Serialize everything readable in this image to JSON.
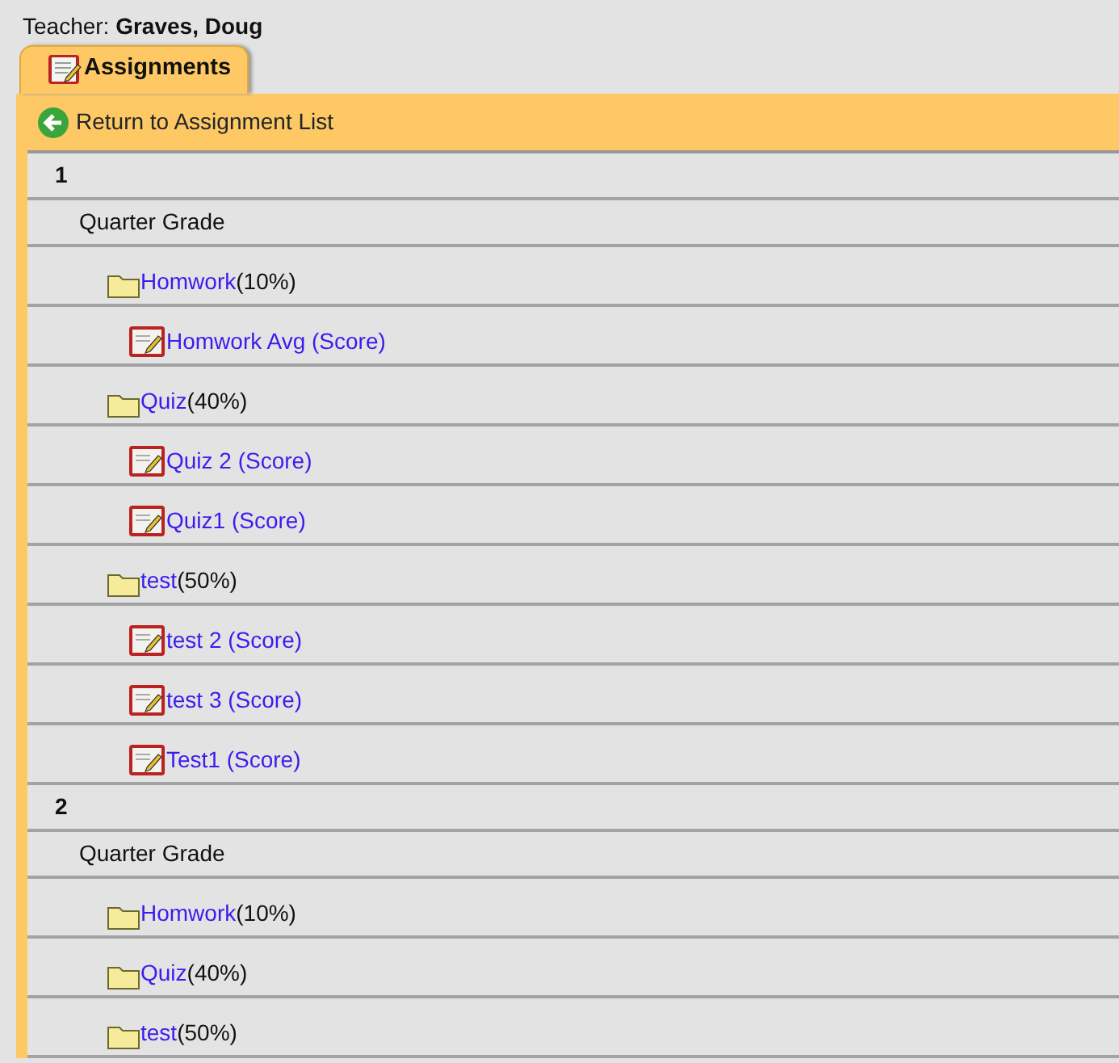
{
  "teacher": {
    "label": "Teacher:",
    "name": "Graves, Doug"
  },
  "tabs": [
    {
      "label": "Assignments",
      "selected": true
    }
  ],
  "toolbar": {
    "link": "Return to Assignment List"
  },
  "terms": [
    {
      "number": "1",
      "children": [
        {
          "label": "Quarter Grade",
          "children": [
            {
              "name": "Homwork",
              "weight": "(10%)",
              "children": [
                {
                  "name": "Homwork Avg",
                  "type": "(Score)"
                }
              ]
            },
            {
              "name": "Quiz",
              "weight": "(40%)",
              "children": [
                {
                  "name": "Quiz 2",
                  "type": "(Score)"
                },
                {
                  "name": "Quiz1",
                  "type": "(Score)"
                }
              ]
            },
            {
              "name": "test",
              "weight": "(50%)",
              "children": [
                {
                  "name": "test 2",
                  "type": "(Score)"
                },
                {
                  "name": "test 3",
                  "type": "(Score)"
                },
                {
                  "name": "Test1",
                  "type": "(Score)"
                }
              ]
            }
          ]
        }
      ]
    },
    {
      "number": "2",
      "children": [
        {
          "label": "Quarter Grade",
          "children": [
            {
              "name": "Homwork",
              "weight": "(10%)"
            },
            {
              "name": "Quiz",
              "weight": "(40%)"
            },
            {
              "name": "test",
              "weight": "(50%)"
            }
          ]
        }
      ]
    }
  ]
}
